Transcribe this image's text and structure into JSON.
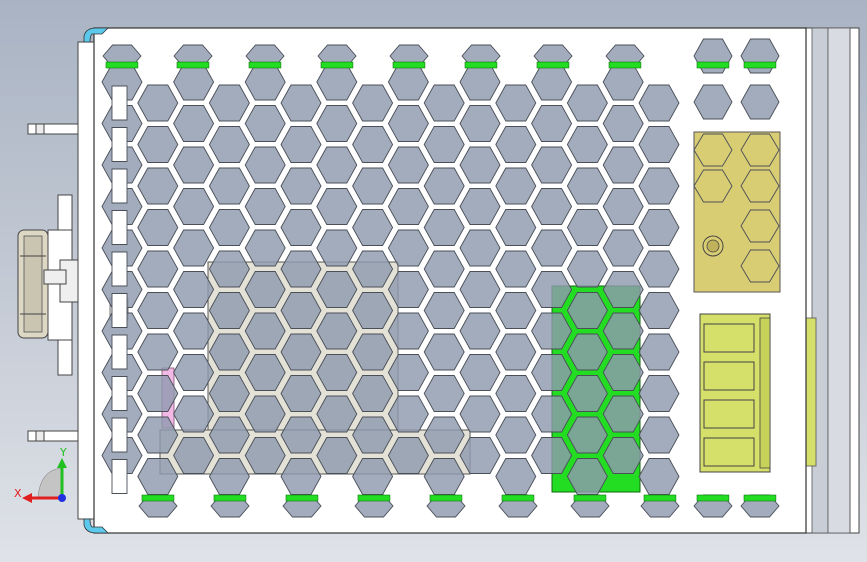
{
  "viewport": {
    "background_top": "#a9b3c3",
    "background_bottom": "#dfe2e8"
  },
  "model": {
    "panel_color": "#ffffff",
    "hole_color": "#8f9aae",
    "hole_outline": "#4a4f58",
    "green_accent": "#22dd22",
    "beige_component": "#e4e2d6",
    "yellow_component": "#d9cd74",
    "terminal_color": "#d4e06a",
    "pink_part": "#f2b8e6",
    "cyan_corner": "#5bc8ec",
    "rail_color": "#c9ced6"
  },
  "triad": {
    "x_label": "X",
    "y_label": "Y",
    "x_color": "#e02020",
    "y_color": "#20c020",
    "z_color": "#2030e0"
  }
}
